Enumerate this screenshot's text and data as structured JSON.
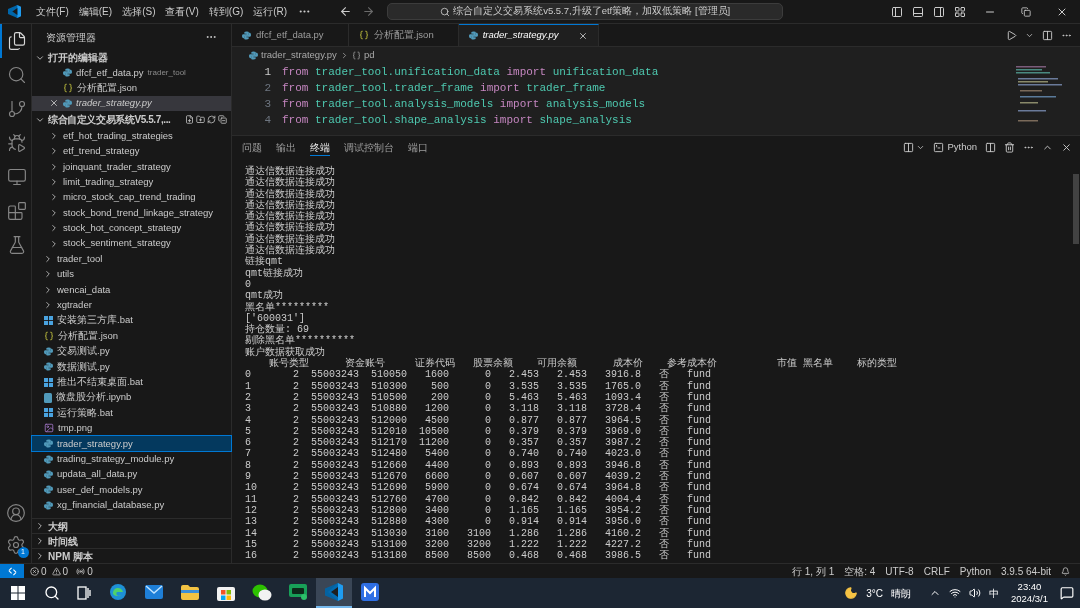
{
  "title_bar": {
    "menus": [
      "文件(F)",
      "编辑(E)",
      "选择(S)",
      "查看(V)",
      "转到(G)",
      "运行(R)"
    ],
    "command_center": "综合自定义交易系统v5.5.7,升级了etf策略，加双低策略 [管理员]"
  },
  "activity_bar": {
    "items": [
      {
        "kind": "explorer",
        "selected": true
      },
      {
        "kind": "search",
        "selected": false
      },
      {
        "kind": "source_control",
        "selected": false
      },
      {
        "kind": "run_debug",
        "selected": false
      },
      {
        "kind": "remote",
        "selected": false
      },
      {
        "kind": "extensions",
        "selected": false
      },
      {
        "kind": "testing",
        "selected": false
      }
    ],
    "settings_badge": "1"
  },
  "sidebar": {
    "title": "资源管理器",
    "open_editors": {
      "title": "打开的编辑器",
      "items": [
        {
          "label": "dfcf_etf_data.py",
          "description": "trader_tool",
          "kind": "py",
          "selected": false
        },
        {
          "label": "分析配置.json",
          "kind": "json",
          "selected": false
        },
        {
          "label": "trader_strategy.py",
          "kind": "py",
          "selected": true
        }
      ]
    },
    "workspace": {
      "title": "综合自定义交易系统V5.5.7,...",
      "partial_folder_children": [
        {
          "label": "etf_hot_trading_strategies",
          "kind": "folder",
          "selected": false
        },
        {
          "label": "etf_trend_strategy",
          "kind": "folder",
          "selected": false
        },
        {
          "label": "joinquant_trader_strategy",
          "kind": "folder",
          "selected": false
        },
        {
          "label": "limit_trading_strategy",
          "kind": "folder",
          "selected": false
        },
        {
          "label": "micro_stock_cap_trend_trading",
          "kind": "folder",
          "selected": false
        },
        {
          "label": "stock_bond_trend_linkage_strategy",
          "kind": "folder",
          "selected": false
        },
        {
          "label": "stock_hot_concept_strategy",
          "kind": "folder",
          "selected": false
        },
        {
          "label": "stock_sentiment_strategy",
          "kind": "folder",
          "selected": false
        }
      ],
      "items": [
        {
          "label": "trader_tool",
          "kind": "folder",
          "selected": false
        },
        {
          "label": "utils",
          "kind": "folder",
          "selected": false
        },
        {
          "label": "wencai_data",
          "kind": "folder",
          "selected": false
        },
        {
          "label": "xgtrader",
          "kind": "folder",
          "selected": false
        },
        {
          "label": "安装第三方库.bat",
          "kind": "bat",
          "selected": false
        },
        {
          "label": "分析配置.json",
          "kind": "json",
          "selected": false
        },
        {
          "label": "交易测试.py",
          "kind": "py",
          "selected": false
        },
        {
          "label": "数据测试.py",
          "kind": "py",
          "selected": false
        },
        {
          "label": "推出不结束桌面.bat",
          "kind": "bat",
          "selected": false
        },
        {
          "label": "微盘股分析.ipynb",
          "kind": "ipynb",
          "selected": false
        },
        {
          "label": "运行策略.bat",
          "kind": "bat",
          "selected": false
        },
        {
          "label": "tmp.png",
          "kind": "png",
          "selected": false
        },
        {
          "label": "trader_strategy.py",
          "kind": "py",
          "selected": true
        },
        {
          "label": "trading_strategy_module.py",
          "kind": "py",
          "selected": false
        },
        {
          "label": "updata_all_data.py",
          "kind": "py",
          "selected": false
        },
        {
          "label": "user_def_models.py",
          "kind": "py",
          "selected": false
        },
        {
          "label": "xg_financial_database.py",
          "kind": "py",
          "selected": false
        }
      ]
    },
    "sections": [
      "大纲",
      "时间线",
      "NPM 脚本"
    ]
  },
  "editor": {
    "tabs": [
      {
        "label": "dfcf_etf_data.py",
        "kind": "py",
        "selected": false
      },
      {
        "label": "分析配置.json",
        "kind": "json",
        "selected": false
      },
      {
        "label": "trader_strategy.py",
        "kind": "py",
        "selected": true
      }
    ],
    "breadcrumb": [
      "trader_strategy.py",
      "pd"
    ],
    "lines": [
      {
        "number": "1",
        "tokens": [
          {
            "kind": "keyword",
            "text": "from"
          },
          {
            "kind": "module",
            "text": "trader_tool.unification_data"
          },
          {
            "kind": "keyword",
            "text": "import"
          },
          {
            "kind": "module",
            "text": "unification_data"
          }
        ]
      },
      {
        "number": "2",
        "tokens": [
          {
            "kind": "keyword",
            "text": "from"
          },
          {
            "kind": "module",
            "text": "trader_tool.trader_frame"
          },
          {
            "kind": "keyword",
            "text": "import"
          },
          {
            "kind": "module",
            "text": "trader_frame"
          }
        ]
      },
      {
        "number": "3",
        "tokens": [
          {
            "kind": "keyword",
            "text": "from"
          },
          {
            "kind": "module",
            "text": "trader_tool.analysis_models"
          },
          {
            "kind": "keyword",
            "text": "import"
          },
          {
            "kind": "module",
            "text": "analysis_models"
          }
        ]
      },
      {
        "number": "4",
        "tokens": [
          {
            "kind": "keyword",
            "text": "from"
          },
          {
            "kind": "module",
            "text": "trader_tool.shape_analysis"
          },
          {
            "kind": "keyword",
            "text": "import"
          },
          {
            "kind": "module",
            "text": "shape_analysis"
          }
        ]
      }
    ]
  },
  "panel": {
    "tabs": [
      {
        "label": "问题",
        "selected": false
      },
      {
        "label": "输出",
        "selected": false
      },
      {
        "label": "终端",
        "selected": true
      },
      {
        "label": "调试控制台",
        "selected": false
      },
      {
        "label": "端口",
        "selected": false
      }
    ],
    "terminal_name": "Python",
    "lines": [
      "通达信数据连接成功",
      "通达信数据连接成功",
      "通达信数据连接成功",
      "通达信数据连接成功",
      "通达信数据连接成功",
      "通达信数据连接成功",
      "通达信数据连接成功",
      "通达信数据连接成功",
      "链接qmt",
      "qmt链接成功",
      "0",
      "qmt成功",
      "黑名单*********",
      "['600031']",
      "持仓数量: 69",
      "剔除黑名单**********",
      "账户数据获取成功",
      "    账号类型      资金账号     证券代码   股票余额    可用余额      成本价    参考成本价          市值 黑名单    标的类型",
      "0       2  55003243  510050   1600      0   2.453   2.453   3916.8   否   fund",
      "1       2  55003243  510300    500      0   3.535   3.535   1765.0   否   fund",
      "2       2  55003243  510500    200      0   5.463   5.463   1093.4   否   fund",
      "3       2  55003243  510880   1200      0   3.118   3.118   3728.4   否   fund",
      "4       2  55003243  512000   4500      0   0.877   0.877   3964.5   否   fund",
      "5       2  55003243  512010  10500      0   0.379   0.379   3969.0   否   fund",
      "6       2  55003243  512170  11200      0   0.357   0.357   3987.2   否   fund",
      "7       2  55003243  512480   5400      0   0.740   0.740   4023.0   否   fund",
      "8       2  55003243  512660   4400      0   0.893   0.893   3946.8   否   fund",
      "9       2  55003243  512670   6600      0   0.607   0.607   4039.2   否   fund",
      "10      2  55003243  512690   5900      0   0.674   0.674   3964.8   否   fund",
      "11      2  55003243  512760   4700      0   0.842   0.842   4004.4   否   fund",
      "12      2  55003243  512800   3400      0   1.165   1.165   3954.2   否   fund",
      "13      2  55003243  512880   4300      0   0.914   0.914   3956.0   否   fund",
      "14      2  55003243  513030   3100   3100   1.286   1.286   4160.2   否   fund",
      "15      2  55003243  513100   3200   3200   1.222   1.222   4227.2   否   fund",
      "16      2  55003243  513180   8500   8500   0.468   0.468   3986.5   否   fund"
    ]
  },
  "status_bar": {
    "errors": "0",
    "warnings": "0",
    "ports": "0",
    "right_items": [
      "行 1, 列 1",
      "空格: 4",
      "UTF-8",
      "CRLF",
      "Python",
      "3.9.5 64-bit"
    ]
  },
  "taskbar": {
    "apps": [
      {
        "kind": "edge",
        "selected": false
      },
      {
        "kind": "mail",
        "selected": false
      },
      {
        "kind": "explorer",
        "selected": false
      },
      {
        "kind": "store",
        "selected": false
      },
      {
        "kind": "wechat",
        "selected": false
      },
      {
        "kind": "chat_app",
        "selected": false
      },
      {
        "kind": "vscode",
        "selected": true
      },
      {
        "kind": "m_app",
        "selected": false
      }
    ],
    "weather": {
      "temperature": "3°C",
      "condition": "晴朗"
    },
    "ime": "中",
    "time": "23:40",
    "date": "2024/3/1"
  }
}
